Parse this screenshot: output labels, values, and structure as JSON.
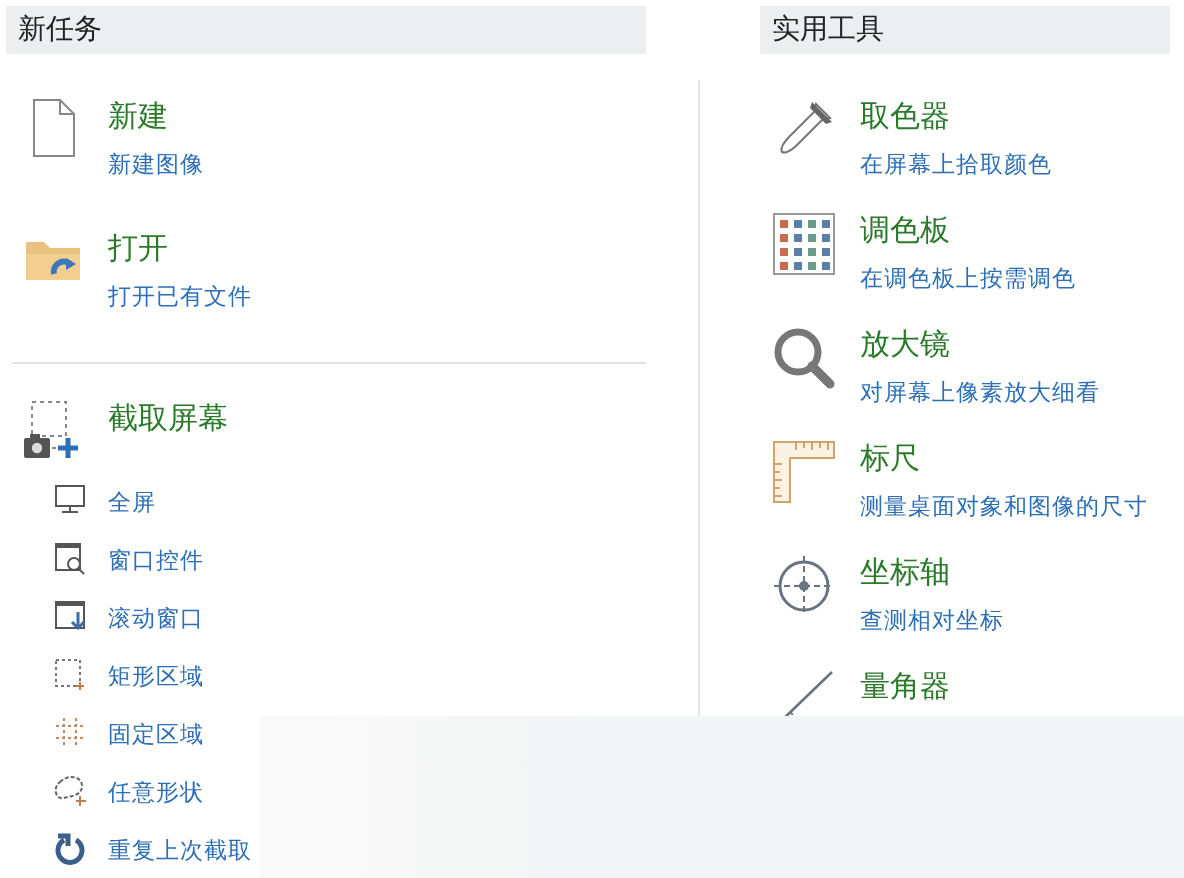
{
  "new_task": {
    "header": "新任务",
    "tasks": [
      {
        "title": "新建",
        "subtitle": "新建图像"
      },
      {
        "title": "打开",
        "subtitle": "打开已有文件"
      }
    ],
    "capture": {
      "title": "截取屏幕",
      "modes": [
        {
          "label": "全屏"
        },
        {
          "label": "窗口控件"
        },
        {
          "label": "滚动窗口"
        },
        {
          "label": "矩形区域"
        },
        {
          "label": "固定区域"
        },
        {
          "label": "任意形状"
        },
        {
          "label": "重复上次截取"
        }
      ]
    }
  },
  "utilities": {
    "header": "实用工具",
    "tools": [
      {
        "title": "取色器",
        "subtitle": "在屏幕上拾取颜色"
      },
      {
        "title": "调色板",
        "subtitle": "在调色板上按需调色"
      },
      {
        "title": "放大镜",
        "subtitle": "对屏幕上像素放大细看"
      },
      {
        "title": "标尺",
        "subtitle": "测量桌面对象和图像的尺寸"
      },
      {
        "title": "坐标轴",
        "subtitle": "查测相对坐标"
      },
      {
        "title": "量角器"
      }
    ]
  }
}
